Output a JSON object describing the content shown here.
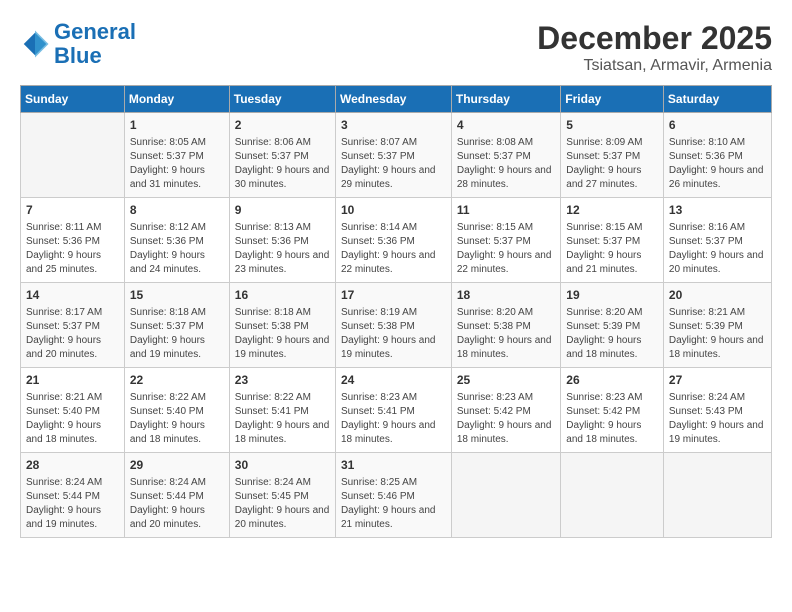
{
  "logo": {
    "line1": "General",
    "line2": "Blue"
  },
  "title": "December 2025",
  "location": "Tsiatsan, Armavir, Armenia",
  "days_of_week": [
    "Sunday",
    "Monday",
    "Tuesday",
    "Wednesday",
    "Thursday",
    "Friday",
    "Saturday"
  ],
  "weeks": [
    [
      {
        "day": "",
        "sunrise": "",
        "sunset": "",
        "daylight": ""
      },
      {
        "day": "1",
        "sunrise": "Sunrise: 8:05 AM",
        "sunset": "Sunset: 5:37 PM",
        "daylight": "Daylight: 9 hours and 31 minutes."
      },
      {
        "day": "2",
        "sunrise": "Sunrise: 8:06 AM",
        "sunset": "Sunset: 5:37 PM",
        "daylight": "Daylight: 9 hours and 30 minutes."
      },
      {
        "day": "3",
        "sunrise": "Sunrise: 8:07 AM",
        "sunset": "Sunset: 5:37 PM",
        "daylight": "Daylight: 9 hours and 29 minutes."
      },
      {
        "day": "4",
        "sunrise": "Sunrise: 8:08 AM",
        "sunset": "Sunset: 5:37 PM",
        "daylight": "Daylight: 9 hours and 28 minutes."
      },
      {
        "day": "5",
        "sunrise": "Sunrise: 8:09 AM",
        "sunset": "Sunset: 5:37 PM",
        "daylight": "Daylight: 9 hours and 27 minutes."
      },
      {
        "day": "6",
        "sunrise": "Sunrise: 8:10 AM",
        "sunset": "Sunset: 5:36 PM",
        "daylight": "Daylight: 9 hours and 26 minutes."
      }
    ],
    [
      {
        "day": "7",
        "sunrise": "Sunrise: 8:11 AM",
        "sunset": "Sunset: 5:36 PM",
        "daylight": "Daylight: 9 hours and 25 minutes."
      },
      {
        "day": "8",
        "sunrise": "Sunrise: 8:12 AM",
        "sunset": "Sunset: 5:36 PM",
        "daylight": "Daylight: 9 hours and 24 minutes."
      },
      {
        "day": "9",
        "sunrise": "Sunrise: 8:13 AM",
        "sunset": "Sunset: 5:36 PM",
        "daylight": "Daylight: 9 hours and 23 minutes."
      },
      {
        "day": "10",
        "sunrise": "Sunrise: 8:14 AM",
        "sunset": "Sunset: 5:36 PM",
        "daylight": "Daylight: 9 hours and 22 minutes."
      },
      {
        "day": "11",
        "sunrise": "Sunrise: 8:15 AM",
        "sunset": "Sunset: 5:37 PM",
        "daylight": "Daylight: 9 hours and 22 minutes."
      },
      {
        "day": "12",
        "sunrise": "Sunrise: 8:15 AM",
        "sunset": "Sunset: 5:37 PM",
        "daylight": "Daylight: 9 hours and 21 minutes."
      },
      {
        "day": "13",
        "sunrise": "Sunrise: 8:16 AM",
        "sunset": "Sunset: 5:37 PM",
        "daylight": "Daylight: 9 hours and 20 minutes."
      }
    ],
    [
      {
        "day": "14",
        "sunrise": "Sunrise: 8:17 AM",
        "sunset": "Sunset: 5:37 PM",
        "daylight": "Daylight: 9 hours and 20 minutes."
      },
      {
        "day": "15",
        "sunrise": "Sunrise: 8:18 AM",
        "sunset": "Sunset: 5:37 PM",
        "daylight": "Daylight: 9 hours and 19 minutes."
      },
      {
        "day": "16",
        "sunrise": "Sunrise: 8:18 AM",
        "sunset": "Sunset: 5:38 PM",
        "daylight": "Daylight: 9 hours and 19 minutes."
      },
      {
        "day": "17",
        "sunrise": "Sunrise: 8:19 AM",
        "sunset": "Sunset: 5:38 PM",
        "daylight": "Daylight: 9 hours and 19 minutes."
      },
      {
        "day": "18",
        "sunrise": "Sunrise: 8:20 AM",
        "sunset": "Sunset: 5:38 PM",
        "daylight": "Daylight: 9 hours and 18 minutes."
      },
      {
        "day": "19",
        "sunrise": "Sunrise: 8:20 AM",
        "sunset": "Sunset: 5:39 PM",
        "daylight": "Daylight: 9 hours and 18 minutes."
      },
      {
        "day": "20",
        "sunrise": "Sunrise: 8:21 AM",
        "sunset": "Sunset: 5:39 PM",
        "daylight": "Daylight: 9 hours and 18 minutes."
      }
    ],
    [
      {
        "day": "21",
        "sunrise": "Sunrise: 8:21 AM",
        "sunset": "Sunset: 5:40 PM",
        "daylight": "Daylight: 9 hours and 18 minutes."
      },
      {
        "day": "22",
        "sunrise": "Sunrise: 8:22 AM",
        "sunset": "Sunset: 5:40 PM",
        "daylight": "Daylight: 9 hours and 18 minutes."
      },
      {
        "day": "23",
        "sunrise": "Sunrise: 8:22 AM",
        "sunset": "Sunset: 5:41 PM",
        "daylight": "Daylight: 9 hours and 18 minutes."
      },
      {
        "day": "24",
        "sunrise": "Sunrise: 8:23 AM",
        "sunset": "Sunset: 5:41 PM",
        "daylight": "Daylight: 9 hours and 18 minutes."
      },
      {
        "day": "25",
        "sunrise": "Sunrise: 8:23 AM",
        "sunset": "Sunset: 5:42 PM",
        "daylight": "Daylight: 9 hours and 18 minutes."
      },
      {
        "day": "26",
        "sunrise": "Sunrise: 8:23 AM",
        "sunset": "Sunset: 5:42 PM",
        "daylight": "Daylight: 9 hours and 18 minutes."
      },
      {
        "day": "27",
        "sunrise": "Sunrise: 8:24 AM",
        "sunset": "Sunset: 5:43 PM",
        "daylight": "Daylight: 9 hours and 19 minutes."
      }
    ],
    [
      {
        "day": "28",
        "sunrise": "Sunrise: 8:24 AM",
        "sunset": "Sunset: 5:44 PM",
        "daylight": "Daylight: 9 hours and 19 minutes."
      },
      {
        "day": "29",
        "sunrise": "Sunrise: 8:24 AM",
        "sunset": "Sunset: 5:44 PM",
        "daylight": "Daylight: 9 hours and 20 minutes."
      },
      {
        "day": "30",
        "sunrise": "Sunrise: 8:24 AM",
        "sunset": "Sunset: 5:45 PM",
        "daylight": "Daylight: 9 hours and 20 minutes."
      },
      {
        "day": "31",
        "sunrise": "Sunrise: 8:25 AM",
        "sunset": "Sunset: 5:46 PM",
        "daylight": "Daylight: 9 hours and 21 minutes."
      },
      {
        "day": "",
        "sunrise": "",
        "sunset": "",
        "daylight": ""
      },
      {
        "day": "",
        "sunrise": "",
        "sunset": "",
        "daylight": ""
      },
      {
        "day": "",
        "sunrise": "",
        "sunset": "",
        "daylight": ""
      }
    ]
  ]
}
